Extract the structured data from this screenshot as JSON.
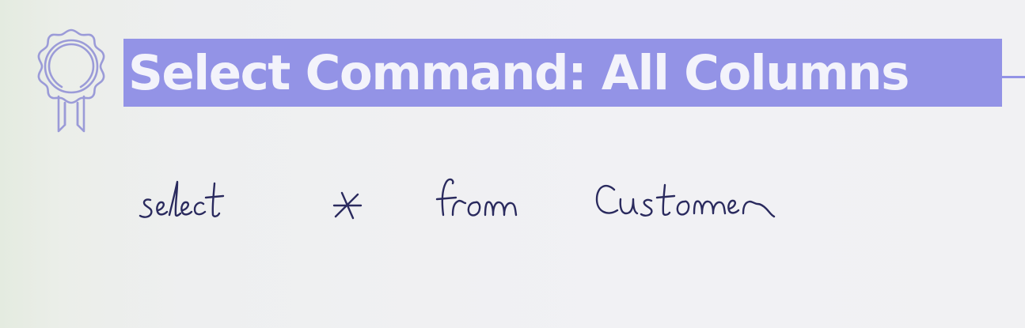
{
  "slide": {
    "title": "Select Command: All Columns",
    "handwritten_query": {
      "word_1": "select",
      "word_2": "*",
      "word_3": "from",
      "word_4": "customer"
    }
  },
  "colors": {
    "title_bar": "#9393e6",
    "title_text": "#f3f3fb",
    "icon_stroke": "#9b9bd8",
    "ink": "#2a2a5e",
    "background": "#f1f1f4"
  },
  "icons": {
    "badge": "award-ribbon-icon"
  }
}
